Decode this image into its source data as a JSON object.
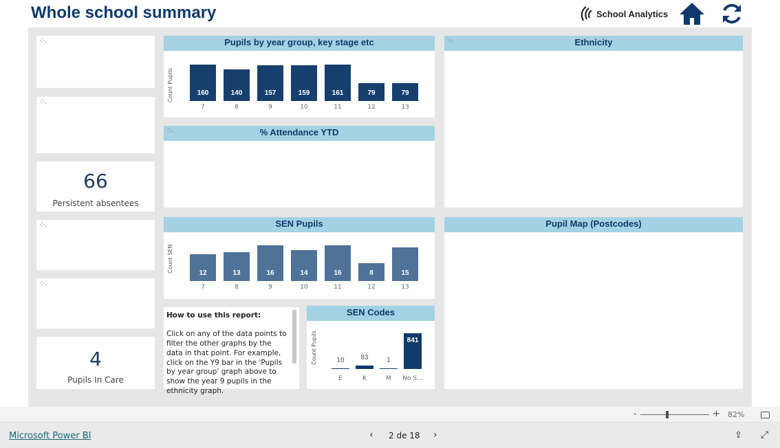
{
  "header": {
    "title": "Whole school summary",
    "brand": "School Analytics",
    "icons": [
      "home-icon",
      "refresh-icon"
    ],
    "accent": "#0f3a6b"
  },
  "kpis": [
    {
      "value": "66",
      "label": "Persistent absentees"
    },
    {
      "value": "4",
      "label": "Pupils In Care"
    }
  ],
  "charts": {
    "pupils": {
      "title": "Pupils by year group, key stage etc",
      "ylabel": "Count Pupils",
      "color": "#163f6e"
    },
    "attendance": {
      "title": "% Attendance YTD"
    },
    "sen": {
      "title": "SEN Pupils",
      "ylabel": "Count SEN",
      "color": "#4f7299"
    },
    "sencodes": {
      "title": "SEN Codes",
      "ylabel": "Count Pupils",
      "color": "#0f3a6b"
    },
    "ethnicity": {
      "title": "Ethnicity"
    },
    "map": {
      "title": "Pupil Map (Postcodes)"
    }
  },
  "chart_data": [
    {
      "type": "bar",
      "title": "Pupils by year group, key stage etc",
      "ylabel": "Count Pupils",
      "categories": [
        "7",
        "8",
        "9",
        "10",
        "11",
        "12",
        "13"
      ],
      "values": [
        160,
        140,
        157,
        159,
        161,
        79,
        79
      ]
    },
    {
      "type": "bar",
      "title": "SEN Pupils",
      "ylabel": "Count SEN",
      "categories": [
        "7",
        "8",
        "9",
        "10",
        "11",
        "12",
        "13"
      ],
      "values": [
        12,
        13,
        16,
        14,
        16,
        8,
        15
      ]
    },
    {
      "type": "bar",
      "title": "SEN Codes",
      "ylabel": "Count Pupils",
      "categories": [
        "E",
        "K",
        "M",
        "No S..."
      ],
      "values": [
        10,
        83,
        1,
        841
      ]
    }
  ],
  "howto": {
    "heading": "How to use this report:",
    "body": "Click on any of the data points to filter the other graphs by the data in that point. For example, click on the Y9 bar in the 'Pupils by year group' graph above to show the year 9 pupils in the ethnicity graph."
  },
  "zoom": {
    "minus": "-",
    "plus": "+",
    "level": "82%",
    "slider_percent": 82
  },
  "footer": {
    "link": "Microsoft Power BI",
    "page": "2 de 18"
  }
}
